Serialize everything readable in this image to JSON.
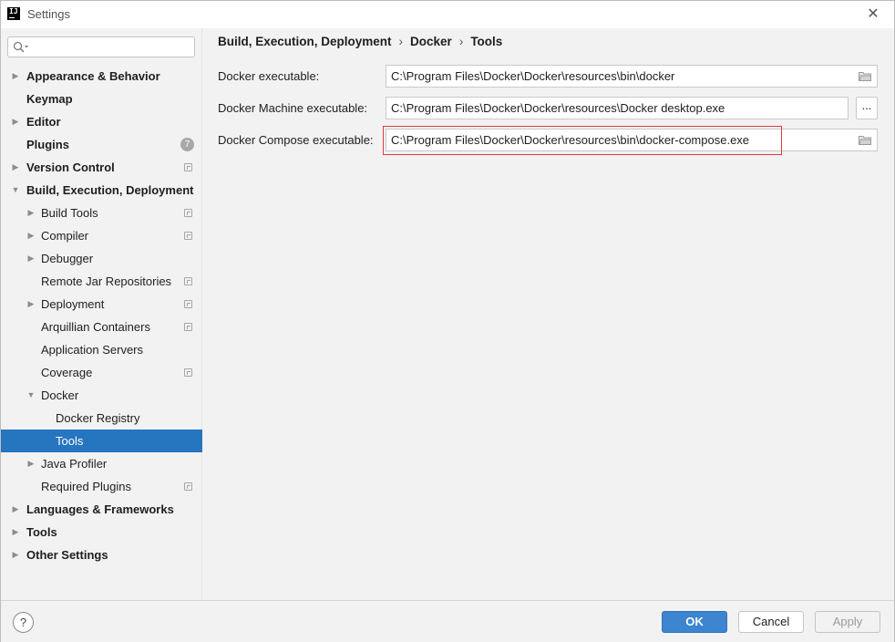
{
  "window": {
    "title": "Settings",
    "app_icon_text": "IJ"
  },
  "search": {
    "placeholder": ""
  },
  "sidebar": {
    "items": [
      {
        "label": "Appearance & Behavior",
        "level": 0,
        "arrow": "right",
        "badge": null,
        "project_icon": false
      },
      {
        "label": "Keymap",
        "level": 0,
        "arrow": null,
        "badge": null,
        "project_icon": false
      },
      {
        "label": "Editor",
        "level": 0,
        "arrow": "right",
        "badge": null,
        "project_icon": false
      },
      {
        "label": "Plugins",
        "level": 0,
        "arrow": null,
        "badge": "7",
        "project_icon": false
      },
      {
        "label": "Version Control",
        "level": 0,
        "arrow": "right",
        "badge": null,
        "project_icon": true
      },
      {
        "label": "Build, Execution, Deployment",
        "level": 0,
        "arrow": "down",
        "badge": null,
        "project_icon": false
      },
      {
        "label": "Build Tools",
        "level": 1,
        "arrow": "right",
        "badge": null,
        "project_icon": true
      },
      {
        "label": "Compiler",
        "level": 1,
        "arrow": "right",
        "badge": null,
        "project_icon": true
      },
      {
        "label": "Debugger",
        "level": 1,
        "arrow": "right",
        "badge": null,
        "project_icon": false
      },
      {
        "label": "Remote Jar Repositories",
        "level": 1,
        "arrow": null,
        "badge": null,
        "project_icon": true
      },
      {
        "label": "Deployment",
        "level": 1,
        "arrow": "right",
        "badge": null,
        "project_icon": true
      },
      {
        "label": "Arquillian Containers",
        "level": 1,
        "arrow": null,
        "badge": null,
        "project_icon": true
      },
      {
        "label": "Application Servers",
        "level": 1,
        "arrow": null,
        "badge": null,
        "project_icon": false
      },
      {
        "label": "Coverage",
        "level": 1,
        "arrow": null,
        "badge": null,
        "project_icon": true
      },
      {
        "label": "Docker",
        "level": 1,
        "arrow": "down",
        "badge": null,
        "project_icon": false
      },
      {
        "label": "Docker Registry",
        "level": 2,
        "arrow": null,
        "badge": null,
        "project_icon": false
      },
      {
        "label": "Tools",
        "level": 2,
        "arrow": null,
        "badge": null,
        "project_icon": false,
        "selected": true
      },
      {
        "label": "Java Profiler",
        "level": 1,
        "arrow": "right",
        "badge": null,
        "project_icon": false
      },
      {
        "label": "Required Plugins",
        "level": 1,
        "arrow": null,
        "badge": null,
        "project_icon": true
      },
      {
        "label": "Languages & Frameworks",
        "level": 0,
        "arrow": "right",
        "badge": null,
        "project_icon": false
      },
      {
        "label": "Tools",
        "level": 0,
        "arrow": "right",
        "badge": null,
        "project_icon": false
      },
      {
        "label": "Other Settings",
        "level": 0,
        "arrow": "right",
        "badge": null,
        "project_icon": false
      }
    ]
  },
  "breadcrumb": {
    "parts": [
      "Build, Execution, Deployment",
      "Docker",
      "Tools"
    ],
    "separator": "›"
  },
  "form": {
    "docker_executable": {
      "label": "Docker executable:",
      "value": "C:\\Program Files\\Docker\\Docker\\resources\\bin\\docker"
    },
    "docker_machine_executable": {
      "label": "Docker Machine executable:",
      "value": "C:\\Program Files\\Docker\\Docker\\resources\\Docker desktop.exe",
      "browse_label": "..."
    },
    "docker_compose_executable": {
      "label": "Docker Compose executable:",
      "value": "C:\\Program Files\\Docker\\Docker\\resources\\bin\\docker-compose.exe"
    }
  },
  "footer": {
    "help_label": "?",
    "ok_label": "OK",
    "cancel_label": "Cancel",
    "apply_label": "Apply"
  },
  "colors": {
    "selection": "#2675bf",
    "ok_button": "#3d85d1",
    "highlight_box": "#e0393e"
  }
}
